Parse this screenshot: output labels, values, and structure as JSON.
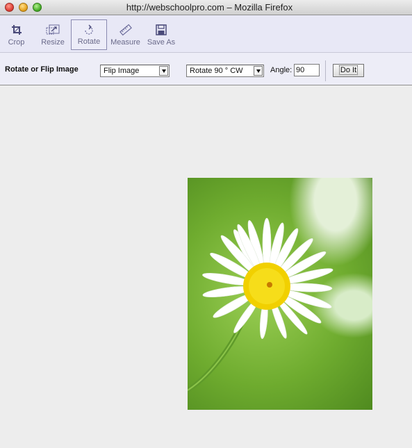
{
  "window": {
    "title": "http://webschoolpro.com – Mozilla Firefox"
  },
  "toolbar": {
    "tools": [
      {
        "label": "Crop",
        "icon": "crop-icon"
      },
      {
        "label": "Resize",
        "icon": "resize-icon"
      },
      {
        "label": "Rotate",
        "icon": "rotate-icon",
        "active": true
      },
      {
        "label": "Measure",
        "icon": "ruler-icon"
      },
      {
        "label": "Save As",
        "icon": "floppy-disk-icon"
      }
    ]
  },
  "options": {
    "title": "Rotate or Flip Image",
    "flip_select": "Flip Image",
    "rotate_select": "Rotate 90 ° CW",
    "angle_label": "Angle:",
    "angle_value": "90",
    "do_button": "Do It"
  },
  "image": {
    "subject": "daisy-flower-photo",
    "colors": {
      "petals": "#ffffff",
      "center": "#f4d400",
      "background": "#7cb83a"
    }
  }
}
